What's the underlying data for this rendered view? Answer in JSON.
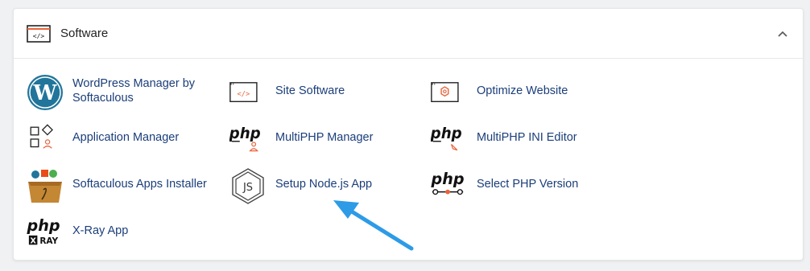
{
  "section": {
    "title": "Software",
    "icon": "code-window-icon",
    "collapse_icon": "chevron-up-icon"
  },
  "items": [
    {
      "label_line1": "WordPress Manager by",
      "label_line2": "Softaculous",
      "icon": "wordpress-icon"
    },
    {
      "label": "Site Software",
      "icon": "code-window-icon"
    },
    {
      "label": "Optimize Website",
      "icon": "optimize-gear-icon"
    },
    {
      "label": "Application Manager",
      "icon": "app-manager-icon"
    },
    {
      "label": "MultiPHP Manager",
      "icon": "php-user-icon"
    },
    {
      "label": "MultiPHP INI Editor",
      "icon": "php-editor-icon"
    },
    {
      "label": "Softaculous Apps Installer",
      "icon": "softaculous-icon"
    },
    {
      "label": "Setup Node.js App",
      "icon": "nodejs-icon"
    },
    {
      "label": "Select PHP Version",
      "icon": "php-version-icon"
    },
    {
      "label": "X-Ray App",
      "icon": "php-xray-icon"
    }
  ],
  "php_text": "php",
  "xray_text": "XRAY",
  "colors": {
    "link": "#1b3e7a",
    "accent": "#e8643c",
    "arrow": "#2d9be6"
  }
}
